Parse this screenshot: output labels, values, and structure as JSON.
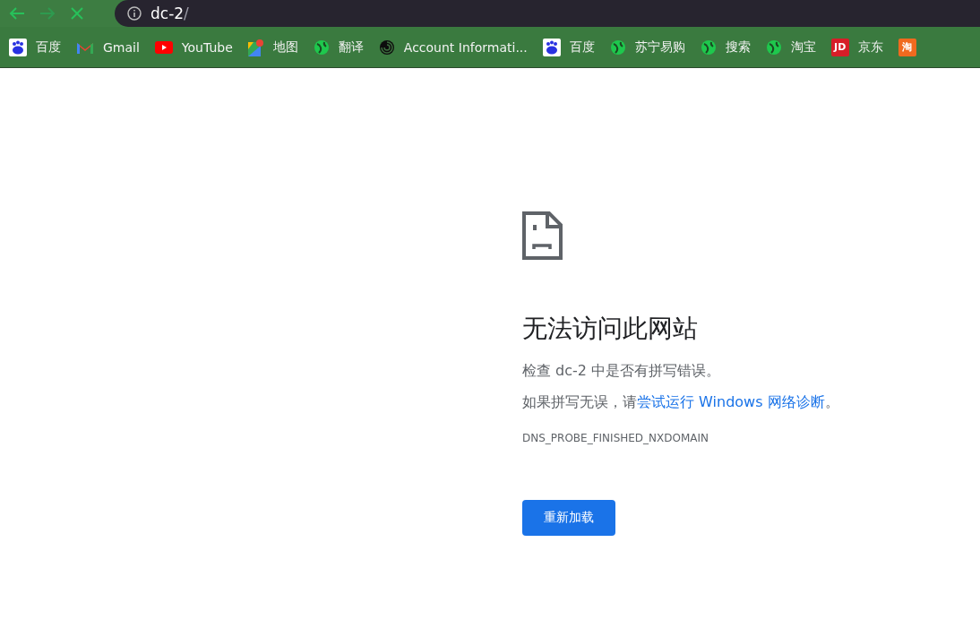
{
  "address_bar": {
    "host": "dc-2",
    "path": "/"
  },
  "bookmarks": [
    {
      "kind": "baidu",
      "label": "百度"
    },
    {
      "kind": "gmail",
      "label": "Gmail"
    },
    {
      "kind": "youtube",
      "label": "YouTube"
    },
    {
      "kind": "maps",
      "label": "地图"
    },
    {
      "kind": "globe",
      "label": "翻译"
    },
    {
      "kind": "swirl",
      "label": "Account Informati..."
    },
    {
      "kind": "baidu",
      "label": "百度"
    },
    {
      "kind": "globe",
      "label": "苏宁易购"
    },
    {
      "kind": "globe",
      "label": "搜索"
    },
    {
      "kind": "globe",
      "label": "淘宝"
    },
    {
      "kind": "jd",
      "label": "京东",
      "logo": "JD"
    },
    {
      "kind": "tao",
      "logo": "淘"
    }
  ],
  "error": {
    "title": "无法访问此网站",
    "check_text": "检查 dc-2 中是否有拼写错误。",
    "suggestion_prefix": "如果拼写无误，请",
    "suggestion_link": "尝试运行 Windows 网络诊断",
    "suggestion_suffix": "。",
    "code": "DNS_PROBE_FINISHED_NXDOMAIN",
    "reload_button": "重新加载"
  }
}
